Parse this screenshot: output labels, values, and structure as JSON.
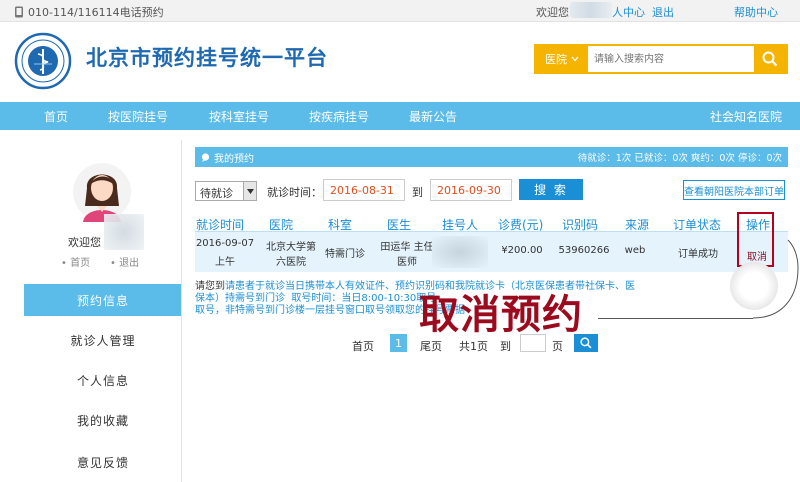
{
  "topbar": {
    "phone": "010-114/116114电话预约",
    "welcome": "欢迎您",
    "user_center": "人中心",
    "logout": "退出",
    "help": "帮助中心"
  },
  "header": {
    "title": "北京市预约挂号统一平台",
    "search_scope": "医院",
    "search_placeholder": "请输入搜索内容"
  },
  "nav": {
    "items": [
      "首页",
      "按医院挂号",
      "按科室挂号",
      "按疾病挂号",
      "最新公告",
      "社会知名医院"
    ]
  },
  "profile": {
    "welcome": "欢迎您",
    "home": "首页",
    "exit": "退出"
  },
  "menu": {
    "items": [
      "预约信息",
      "就诊人管理",
      "个人信息",
      "我的收藏",
      "意见反馈"
    ],
    "active_index": 0
  },
  "panel": {
    "title": "我的预约",
    "stats": "待就诊：1次  已就诊：0次  爽约：0次  停诊：0次"
  },
  "filter": {
    "status": "待就诊",
    "label": "就诊时间：",
    "date_from": "2016-08-31",
    "to": "到",
    "date_to": "2016-09-30",
    "query_button": "搜 索",
    "chaoyang_button": "查看朝阳医院本部订单"
  },
  "table": {
    "headers": [
      "就诊时间",
      "医院",
      "科室",
      "医生",
      "挂号人",
      "诊费(元)",
      "识别码",
      "来源",
      "订单状态",
      "操作"
    ],
    "row": {
      "date": "2016-09-07",
      "period": "上午",
      "hospital_line1": "北京大学第",
      "hospital_line2": "六医院",
      "department": "特需门诊",
      "doctor_line1": "田运华 主任",
      "doctor_line2": "医师",
      "fee": "¥200.00",
      "code": "53960266",
      "source": "web",
      "status": "订单成功",
      "action": "取消"
    }
  },
  "notice": {
    "p1": "请您到",
    "p2": "请患者于就诊当日携带本人有效证件、预约识别码和我院就诊卡（北京医保患者带社保卡、医保本）持需号到门诊",
    "p3": "取号，非特需号到门诊楼一层挂号窗口取号领取您的挂号票据",
    "time_label": "取号时间：当日8:00-10:30取号"
  },
  "annotation": "取消预约",
  "pager": {
    "first": "首页",
    "current": "1",
    "last": "尾页",
    "total": "共1页",
    "goto": "到",
    "page_unit": "页"
  },
  "colors": {
    "nav_blue": "#5bbbe9",
    "link_blue": "#1a8fd6",
    "search_yellow": "#f4b400",
    "date_red": "#e04e1c",
    "annotation_red": "#9c0a1e",
    "title_blue": "#1f69b1"
  }
}
